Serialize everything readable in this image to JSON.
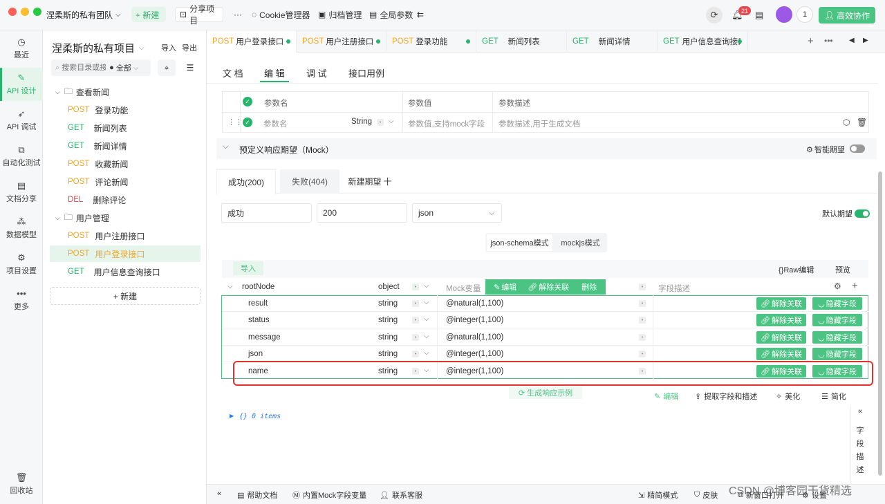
{
  "app": {
    "team": "涅柔斯的私有团队",
    "new_btn": "+ 新建",
    "share": "分享项目",
    "more": "···",
    "cookie": "Cookie管理器",
    "archive": "归档管理",
    "globals": "全局参数",
    "notif_count": "21",
    "user_num": "1",
    "collab": "高效协作"
  },
  "rail": {
    "recent": "最近",
    "api_design": "API 设计",
    "api_debug": "API 调试",
    "auto_test": "自动化测试",
    "doc_share": "文档分享",
    "data_model": "数据模型",
    "settings": "项目设置",
    "more": "更多",
    "recycle": "回收站"
  },
  "tree": {
    "project": "涅柔斯的私有项目",
    "import": "导入",
    "export": "导出",
    "search_placeholder": "搜索目录或接口",
    "filter": "全部",
    "new": "+ 新建",
    "folders": [
      {
        "name": "查看新闻"
      },
      {
        "name": "用户管理"
      }
    ],
    "items": [
      {
        "method": "POST",
        "name": "登录功能"
      },
      {
        "method": "GET",
        "name": "新闻列表"
      },
      {
        "method": "GET",
        "name": "新闻详情"
      },
      {
        "method": "POST",
        "name": "收藏新闻"
      },
      {
        "method": "POST",
        "name": "评论新闻"
      },
      {
        "method": "DEL",
        "name": "删除评论"
      },
      {
        "method": "POST",
        "name": "用户注册接口"
      },
      {
        "method": "POST",
        "name": "用户登录接口"
      },
      {
        "method": "GET",
        "name": "用户信息查询接口"
      }
    ]
  },
  "tabs": [
    {
      "method": "POST",
      "name": "用户登录接口"
    },
    {
      "method": "POST",
      "name": "用户注册接口"
    },
    {
      "method": "POST",
      "name": "登录功能"
    },
    {
      "method": "GET",
      "name": "新闻列表"
    },
    {
      "method": "GET",
      "name": "新闻详情"
    },
    {
      "method": "GET",
      "name": "用户信息查询接口"
    }
  ],
  "subtabs": [
    "文 档",
    "编 辑",
    "调 试",
    "接口用例"
  ],
  "params": {
    "h_name": "参数名",
    "h_value": "参数值",
    "h_desc": "参数描述",
    "name_ph": "参数名",
    "type": "String",
    "value_ph": "参数值,支持mock字段",
    "desc_ph": "参数描述,用于生成文档"
  },
  "mock": {
    "title": "预定义响应期望（Mock）",
    "smart": "智能期望",
    "tab_ok": "成功(200)",
    "tab_fail": "失败(404)",
    "tab_new": "新建期望 十",
    "name": "成功",
    "code": "200",
    "format": "json",
    "default": "默认期望",
    "mode1": "json-schema模式",
    "mode2": "mockjs模式",
    "import": "导入",
    "raw": "{}Raw编辑",
    "preview": "预览",
    "root": {
      "name": "rootNode",
      "type": "object",
      "mockvar": "Mock变量",
      "edit": "编辑",
      "unlink": "解除关联",
      "delete": "删除",
      "desc": "字段描述"
    },
    "rows": [
      {
        "name": "result",
        "type": "string",
        "mock": "@natural(1,100)"
      },
      {
        "name": "status",
        "type": "string",
        "mock": "@integer(1,100)"
      },
      {
        "name": "message",
        "type": "string",
        "mock": "@natural(1,100)"
      },
      {
        "name": "json",
        "type": "string",
        "mock": "@integer(1,100)"
      },
      {
        "name": "name",
        "type": "string",
        "mock": "@integer(1,100)"
      }
    ],
    "row_unlink": "解除关联",
    "row_hide": "隐藏字段",
    "gen": "生成响应示例",
    "edit2": "编辑",
    "extract": "提取字段和描述",
    "beautify": "美化",
    "simplify": "简化",
    "json_preview": "{}  0 items",
    "side": [
      "字",
      "段",
      "描",
      "述"
    ]
  },
  "bottom": {
    "help": "帮助文档",
    "mockvars": "内置Mock字段变量",
    "support": "联系客服",
    "simple": "精简模式",
    "skin": "皮肤",
    "newwin": "新窗口打开",
    "settings": "设置",
    "watermark": "CSDN @博客园干货精选"
  },
  "colors": {
    "accent": "#28b46d",
    "post": "#f5a623",
    "get": "#28b46d",
    "del": "#e5484d",
    "highlight": "#e0312f"
  }
}
